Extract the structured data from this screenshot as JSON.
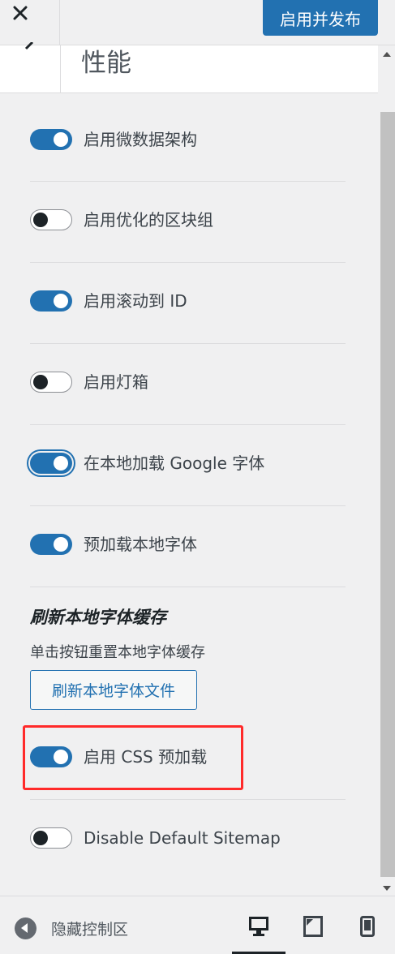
{
  "topbar": {
    "close_icon": "close-icon",
    "publish_label": "启用并发布"
  },
  "section": {
    "back_icon": "chevron-left-icon",
    "title": "性能"
  },
  "settings": [
    {
      "label": "启用微数据架构",
      "enabled": true
    },
    {
      "label": "启用优化的区块组",
      "enabled": false
    },
    {
      "label": "启用滚动到 ID",
      "enabled": true
    },
    {
      "label": "启用灯箱",
      "enabled": false
    },
    {
      "label": "在本地加载 Google 字体",
      "enabled": true,
      "focused": true
    },
    {
      "label": "预加载本地字体",
      "enabled": true
    }
  ],
  "cache": {
    "title": "刷新本地字体缓存",
    "description": "单击按钮重置本地字体缓存",
    "button_label": "刷新本地字体文件"
  },
  "settings_bottom": [
    {
      "label": "启用 CSS 预加载",
      "enabled": true,
      "highlighted": true
    },
    {
      "label": "Disable Default Sitemap",
      "enabled": false
    }
  ],
  "footer": {
    "collapse_label": "隐藏控制区",
    "devices": [
      "desktop-icon",
      "tablet-icon",
      "mobile-icon"
    ],
    "active_device": "desktop-icon"
  },
  "colors": {
    "accent": "#2271b1",
    "highlight": "#ff2a2a",
    "background": "#f0f0f1"
  }
}
